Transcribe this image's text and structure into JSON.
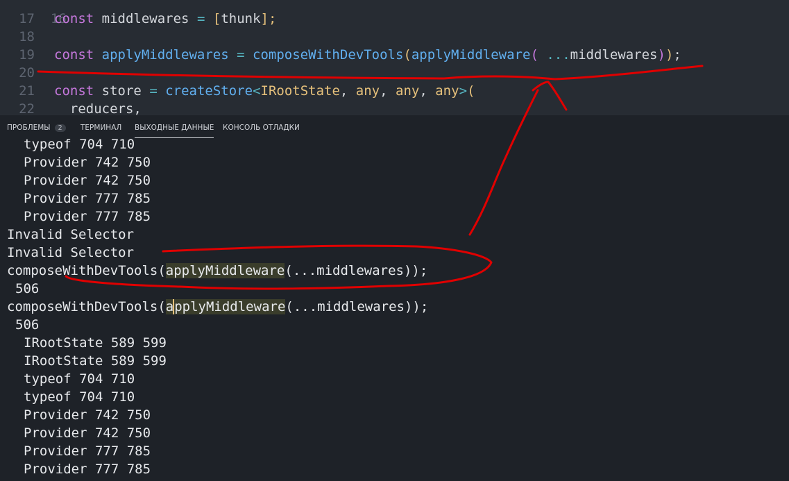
{
  "editor": {
    "lines": [
      {
        "num": "16",
        "text": ""
      },
      {
        "num": "17",
        "kw": "const",
        "name": "middlewares",
        "op": "=",
        "open": "[",
        "arg": "thunk",
        "close": "];"
      },
      {
        "num": "18",
        "text": ""
      },
      {
        "num": "19",
        "kw": "const",
        "name": "applyMiddlewares",
        "op": "=",
        "fn1": "composeWithDevTools",
        "p1": "(",
        "fn2": "applyMiddleware",
        "p2": "(",
        "spread": "...",
        "arg": "middlewares",
        "p3": ")",
        "p4": ")",
        "end": ";"
      },
      {
        "num": "20",
        "text": ""
      },
      {
        "num": "21",
        "kw": "const",
        "name": "store",
        "op": "=",
        "fn": "createStore",
        "lt": "<",
        "t1": "IRootState",
        "t2": "any",
        "t3": "any",
        "t4": "any",
        "gt": ">",
        "p": "("
      },
      {
        "num": "22",
        "text": "reducers,"
      }
    ]
  },
  "panel": {
    "tabs": {
      "problems": "ПРОБЛЕМЫ",
      "problems_count": "2",
      "terminal": "ТЕРМИНАЛ",
      "output": "ВЫХОДНЫЕ ДАННЫЕ",
      "debug_console": "КОНСОЛЬ ОТЛАДКИ"
    },
    "output_lines": [
      "typeof 704 710",
      "Provider 742 750",
      "Provider 742 750",
      "Provider 777 785",
      "Provider 777 785",
      "Invalid Selector",
      "Invalid Selector",
      "composeWithDevTools(applyMiddleware(...middlewares));",
      "506",
      "composeWithDevTools(applyMiddleware(...middlewares));",
      "506",
      "IRootState 589 599",
      "IRootState 589 599",
      "typeof 704 710",
      "typeof 704 710",
      "Provider 742 750",
      "Provider 742 750",
      "Provider 777 785",
      "Provider 777 785"
    ],
    "compose_parts": {
      "prefix": "composeWithDevTools(",
      "hl_a": "a",
      "hl_rest": "pplyMiddleware",
      "hl_full": "applyMiddleware",
      "suffix": "(...middlewares));"
    }
  },
  "colors": {
    "editor_bg": "#272c33",
    "panel_bg": "#1e2228",
    "keyword": "#c678dd",
    "function": "#61afef",
    "type": "#e5c07b",
    "annotation": "#e00000"
  }
}
